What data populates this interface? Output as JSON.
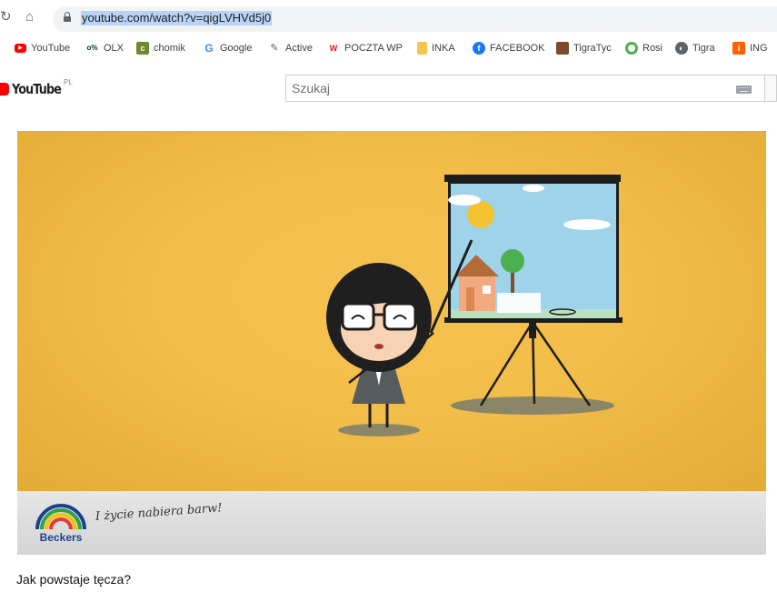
{
  "browser": {
    "url": "youtube.com/watch?v=qigLVHVd5j0",
    "bookmarks": [
      {
        "label": "YouTube",
        "icon": "youtube-icon",
        "color": "#ff0000"
      },
      {
        "label": "OLX",
        "icon": "olx-icon",
        "color": "#002f34"
      },
      {
        "label": "chomik",
        "icon": "chomik-icon",
        "color": "#6a8b2a"
      },
      {
        "label": "Google",
        "icon": "google-icon",
        "color": "#4285f4"
      },
      {
        "label": "Active",
        "icon": "active-icon",
        "color": "#5f6368"
      },
      {
        "label": "POCZTA WP",
        "icon": "wp-icon",
        "color": "#e3101b"
      },
      {
        "label": "INKA",
        "icon": "folder-icon",
        "color": "#f4c64e"
      },
      {
        "label": "FACEBOOK",
        "icon": "facebook-icon",
        "color": "#1877f2"
      },
      {
        "label": "TigraTyc",
        "icon": "tigra-icon",
        "color": "#7a4a2a"
      },
      {
        "label": "Rosi",
        "icon": "rosi-icon",
        "color": "#4caf50"
      },
      {
        "label": "Tigra",
        "icon": "globe-icon",
        "color": "#5f6368"
      },
      {
        "label": "ING",
        "icon": "ing-icon",
        "color": "#ff6200"
      }
    ]
  },
  "youtube": {
    "logo_text": "YouTube",
    "country": "PL",
    "search_placeholder": "Szukaj"
  },
  "video": {
    "brand": "Beckers",
    "tagline": "I życie nabiera barw!",
    "title": "Jak powstaje tęcza?"
  }
}
